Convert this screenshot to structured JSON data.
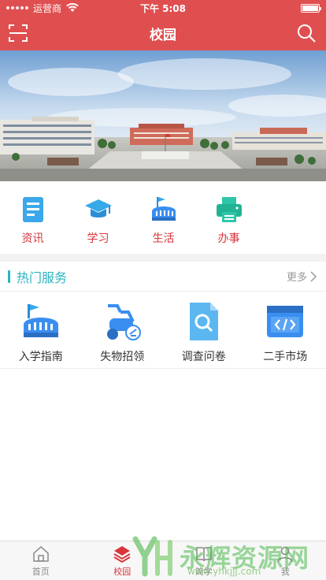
{
  "status_bar": {
    "carrier": "运营商",
    "time": "下午 5:08",
    "battery_level": 1.0
  },
  "nav": {
    "title": "校园",
    "left_icon": "scan-icon",
    "right_icon": "search-icon"
  },
  "quick_links": [
    {
      "label": "资讯",
      "icon": "news-icon"
    },
    {
      "label": "学习",
      "icon": "graduation-cap-icon"
    },
    {
      "label": "生活",
      "icon": "stadium-icon"
    },
    {
      "label": "办事",
      "icon": "printer-icon"
    }
  ],
  "hot_services": {
    "title": "热门服务",
    "more_label": "更多",
    "items": [
      {
        "label": "入学指南",
        "icon": "stadium-icon"
      },
      {
        "label": "失物招领",
        "icon": "scooter-icon"
      },
      {
        "label": "调查问卷",
        "icon": "document-search-icon"
      },
      {
        "label": "二手市场",
        "icon": "code-window-icon"
      }
    ]
  },
  "tab_bar": {
    "tabs": [
      {
        "label": "首页",
        "icon": "home-icon",
        "active": false
      },
      {
        "label": "校园",
        "icon": "layers-icon",
        "active": true
      },
      {
        "label": "简学",
        "icon": "book-icon",
        "active": false
      },
      {
        "label": "我",
        "icon": "user-icon",
        "active": false
      }
    ]
  },
  "watermark": {
    "text": "永辉资源网",
    "url": "www.yhkjjj.com"
  },
  "colors": {
    "primary": "#e04f50",
    "accent_teal": "#2ab3c1",
    "icon_blue": "#3a8ef0"
  }
}
